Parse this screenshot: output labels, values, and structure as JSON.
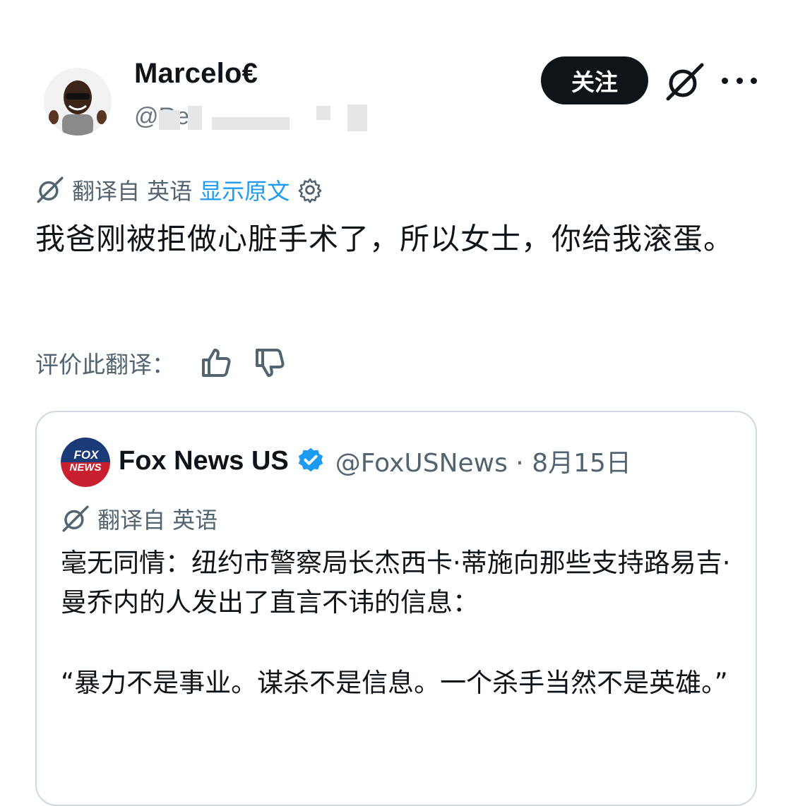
{
  "author": {
    "display_name": "Marcelo€",
    "handle_visible": "@Re"
  },
  "header": {
    "follow_label": "关注"
  },
  "translation": {
    "label": "翻译自 英语",
    "show_original": "显示原文"
  },
  "tweet": {
    "text": "我爸刚被拒做心脏手术了，所以女士，你给我滚蛋。"
  },
  "rating": {
    "label": "评价此翻译："
  },
  "quote": {
    "name": "Fox News US",
    "meta": "@FoxUSNews · 8月15日",
    "logo_text_top": "FOX",
    "logo_text_bottom": "NEWS",
    "translation_label": "翻译自 英语",
    "paragraph1": "毫无同情：纽约市警察局长杰西卡·蒂施向那些支持路易吉·曼乔内的人发出了直言不讳的信息：",
    "paragraph2": "“暴力不是事业。谋杀不是信息。一个杀手当然不是英雄。”"
  },
  "colors": {
    "link": "#1d9bf0",
    "muted": "#536471",
    "verified": "#1d9bf0",
    "button_bg": "#0f1419"
  },
  "icons": [
    "grok-icon",
    "more-icon",
    "translate-icon",
    "gear-icon",
    "thumbs-up-icon",
    "thumbs-down-icon",
    "verified-badge-icon"
  ]
}
